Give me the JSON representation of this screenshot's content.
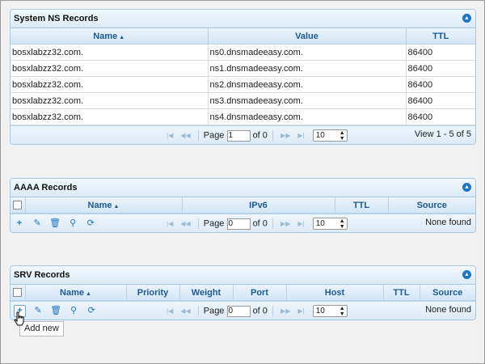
{
  "ns_panel": {
    "title": "System NS Records",
    "columns": [
      "Name",
      "Value",
      "TTL"
    ],
    "rows": [
      [
        "bosxlabzz32.com.",
        "ns0.dnsmadeeasy.com.",
        "86400"
      ],
      [
        "bosxlabzz32.com.",
        "ns1.dnsmadeeasy.com.",
        "86400"
      ],
      [
        "bosxlabzz32.com.",
        "ns2.dnsmadeeasy.com.",
        "86400"
      ],
      [
        "bosxlabzz32.com.",
        "ns3.dnsmadeeasy.com.",
        "86400"
      ],
      [
        "bosxlabzz32.com.",
        "ns4.dnsmadeeasy.com.",
        "86400"
      ]
    ],
    "pager": {
      "page_label": "Page",
      "page_value": "1",
      "of_label": "of 0",
      "page_size": "10",
      "info": "View 1 - 5 of 5"
    }
  },
  "aaaa_panel": {
    "title": "AAAA Records",
    "columns": [
      "Name",
      "IPv6",
      "TTL",
      "Source"
    ],
    "pager": {
      "page_label": "Page",
      "page_value": "0",
      "of_label": "of 0",
      "page_size": "10",
      "info": "None found"
    }
  },
  "srv_panel": {
    "title": "SRV Records",
    "columns": [
      "Name",
      "Priority",
      "Weight",
      "Port",
      "Host",
      "TTL",
      "Source"
    ],
    "pager": {
      "page_label": "Page",
      "page_value": "0",
      "of_label": "of 0",
      "page_size": "10",
      "info": "None found"
    }
  },
  "tooltip": "Add new",
  "icons": {
    "toolbar": [
      "add-icon",
      "edit-icon",
      "delete-icon",
      "search-icon",
      "refresh-icon"
    ],
    "collapse": "collapse-up-icon"
  },
  "colors": {
    "header_text": "#1d5a95",
    "accent": "#1f76c2",
    "panel_border": "#a8c8e0"
  }
}
